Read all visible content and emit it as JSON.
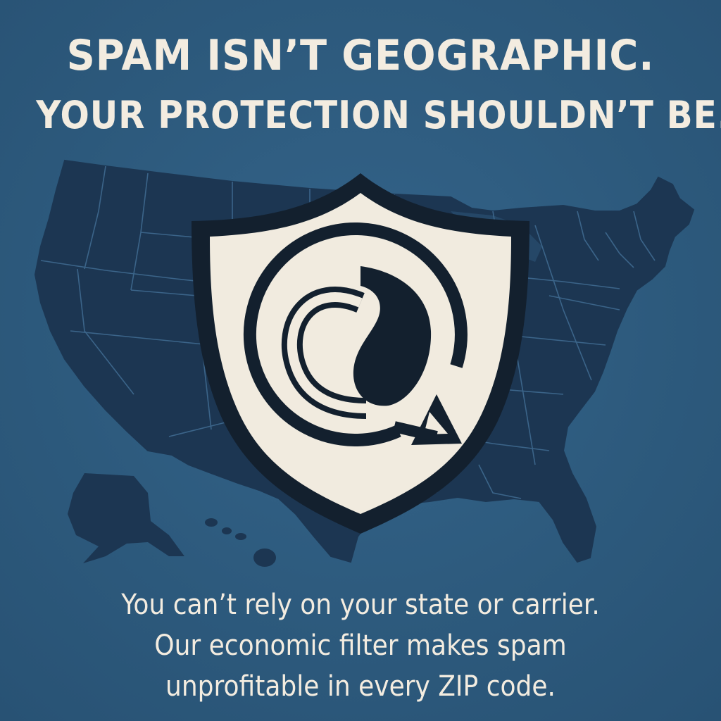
{
  "headline": {
    "line1": "SPAM ISN’T GEOGRAPHIC.",
    "line2": "YOUR PROTECTION SHOULDN’T BE."
  },
  "body": {
    "line1": "You can’t rely on your state or carrier.",
    "line2": "Our economic filter makes spam",
    "line3": "unprofitable in every ZIP code."
  },
  "colors": {
    "background": "#2e5a7e",
    "map": "#1c3652",
    "state_borders": "#3f6a8f",
    "shield_fill": "#f1ebdf",
    "shield_outline": "#13202e",
    "text": "#f3ece0"
  },
  "icons": {
    "map": "usa-map-icon",
    "shield": "shield-icon",
    "emblem": "spiral-arrow-emblem-icon"
  }
}
